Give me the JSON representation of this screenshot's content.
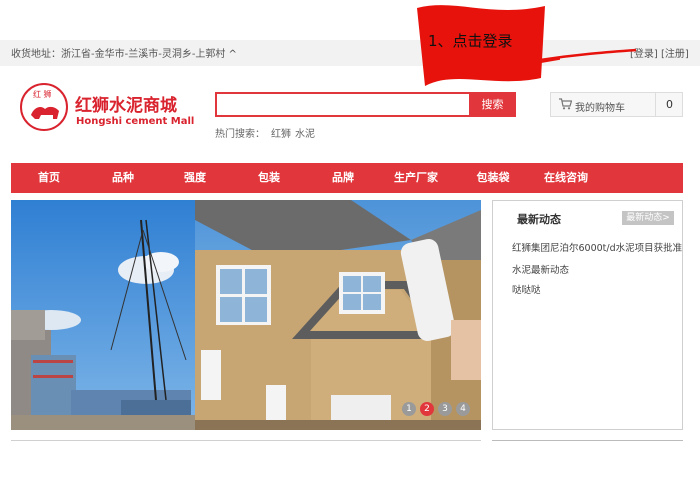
{
  "topbar": {
    "address": "收货地址：浙江省-金华市-兰溪市-灵洞乡-上郭村",
    "login": "[登录]",
    "register": "[注册]"
  },
  "annotation": {
    "text": "1、点击登录"
  },
  "logo": {
    "badge": "红 狮",
    "name_cn": "红狮水泥商城",
    "name_en": "Hongshi cement Mall"
  },
  "search": {
    "placeholder": "",
    "button": "搜索",
    "hot_label": "热门搜索：",
    "hot_keywords": [
      "红狮",
      "水泥"
    ]
  },
  "cart": {
    "label": "我的购物车",
    "count": "0"
  },
  "nav": {
    "items": [
      "首页",
      "品种",
      "强度",
      "包装",
      "品牌",
      "生产厂家",
      "包装袋",
      "在线咨询"
    ]
  },
  "banner": {
    "pages": [
      "1",
      "2",
      "3",
      "4"
    ],
    "active_page": "2"
  },
  "news": {
    "title": "最新动态",
    "more": "最新动态>",
    "items": [
      "红狮集团尼泊尔6000t/d水泥项目获批准",
      "水泥最新动态",
      "哒哒哒"
    ]
  },
  "colors": {
    "brand_red": "#e1363c",
    "logo_red": "#d9232e"
  }
}
